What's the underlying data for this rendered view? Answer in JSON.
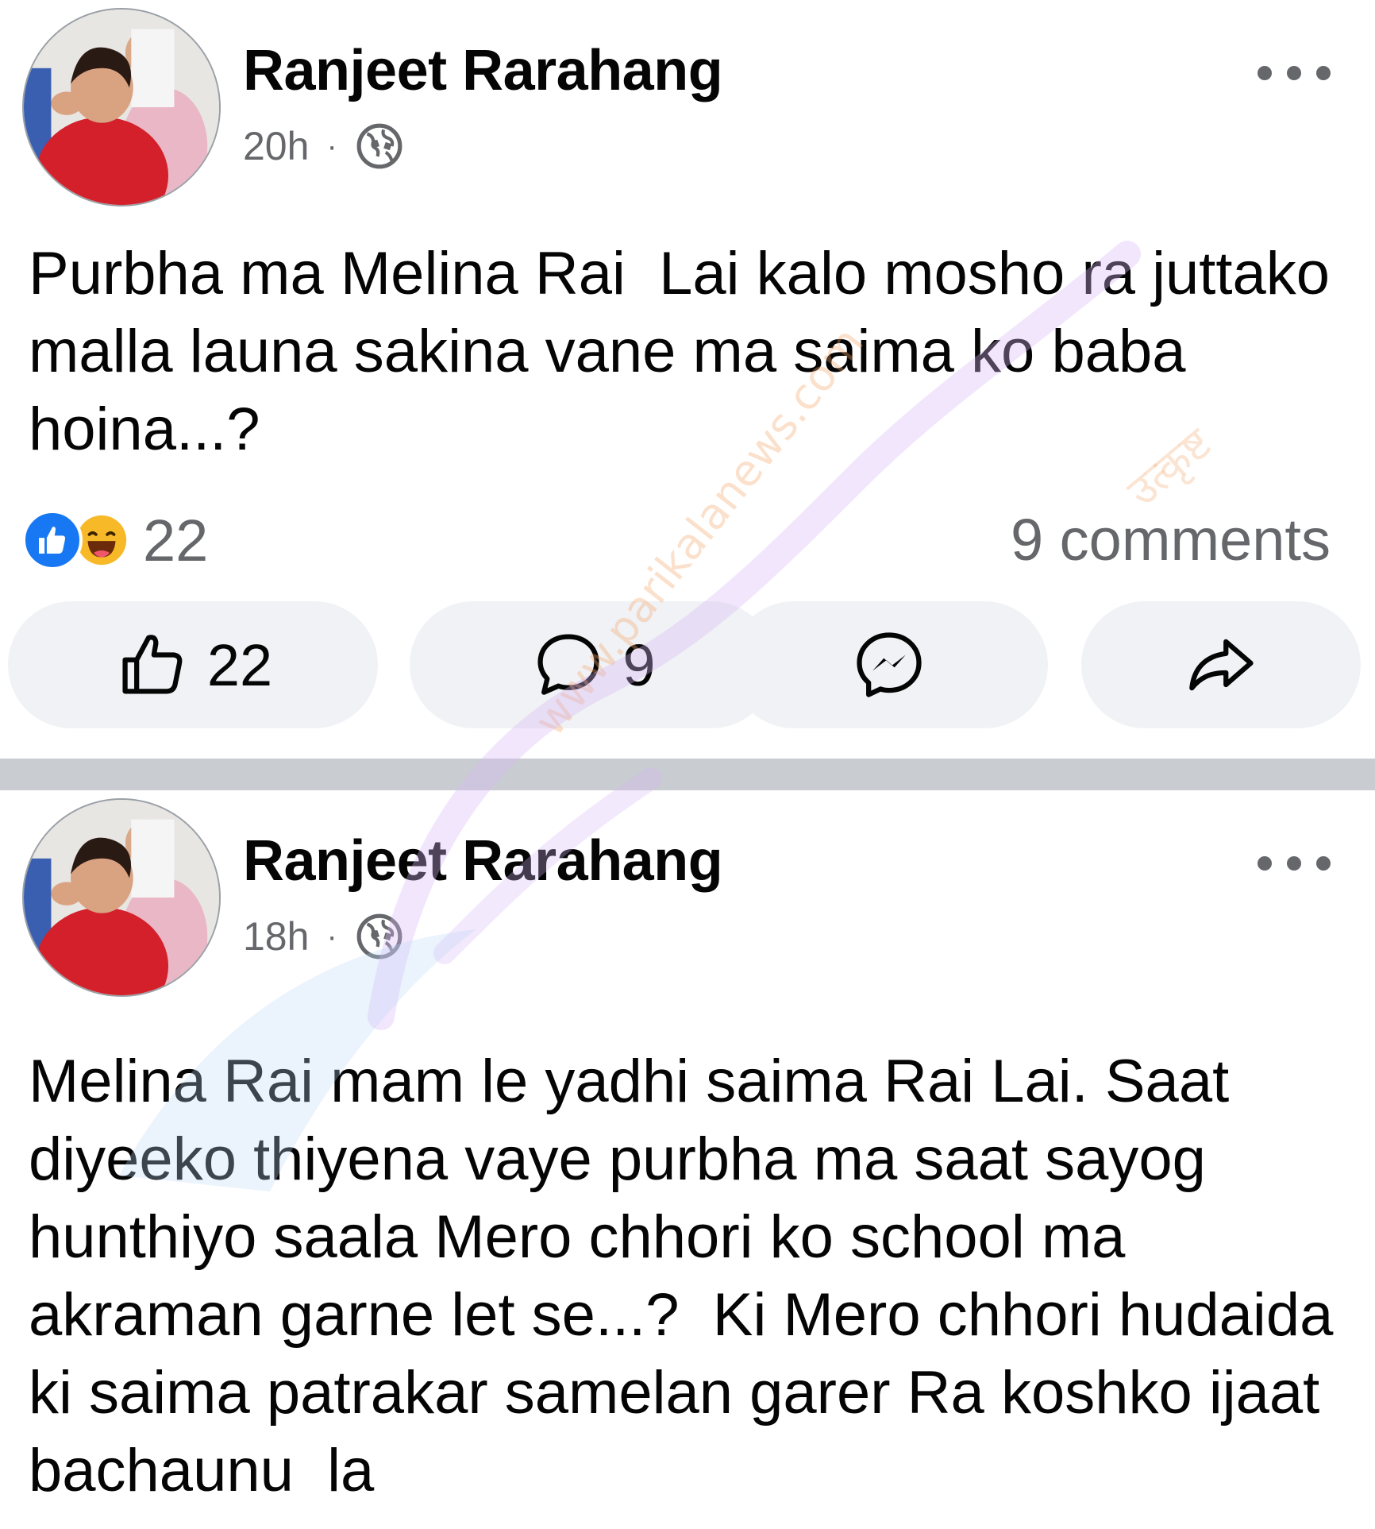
{
  "posts": [
    {
      "author": "Ranjeet Rarahang",
      "time": "20h",
      "separator": "·",
      "audience_icon": "globe-icon",
      "text": "Purbha ma Melina Rai  Lai kalo mosho ra juttako malla launa sakina vane ma saima ko baba hoina...?",
      "reaction_count": "22",
      "comments_label": "9 comments",
      "actions": {
        "like": "22",
        "comment": "9"
      }
    },
    {
      "author": "Ranjeet Rarahang",
      "time": "18h",
      "separator": "·",
      "audience_icon": "globe-icon",
      "text": "Melina Rai mam le yadhi saima Rai Lai. Saat diyeeko thiyena vaye purbha ma saat sayog hunthiyo saala Mero chhori ko school ma akraman garne let se...?  Ki Mero chhori hudaida ki saima patrakar samelan garer Ra koshko ijaat bachaunu  la"
    }
  ],
  "watermark": {
    "site": "www.parikalanews.com",
    "tagline": "उत्कृष्ट"
  },
  "colors": {
    "accent": "#1877f2",
    "secondary_text": "#65676b",
    "button_bg": "#f0f2f5",
    "divider": "#c9ccd1"
  }
}
